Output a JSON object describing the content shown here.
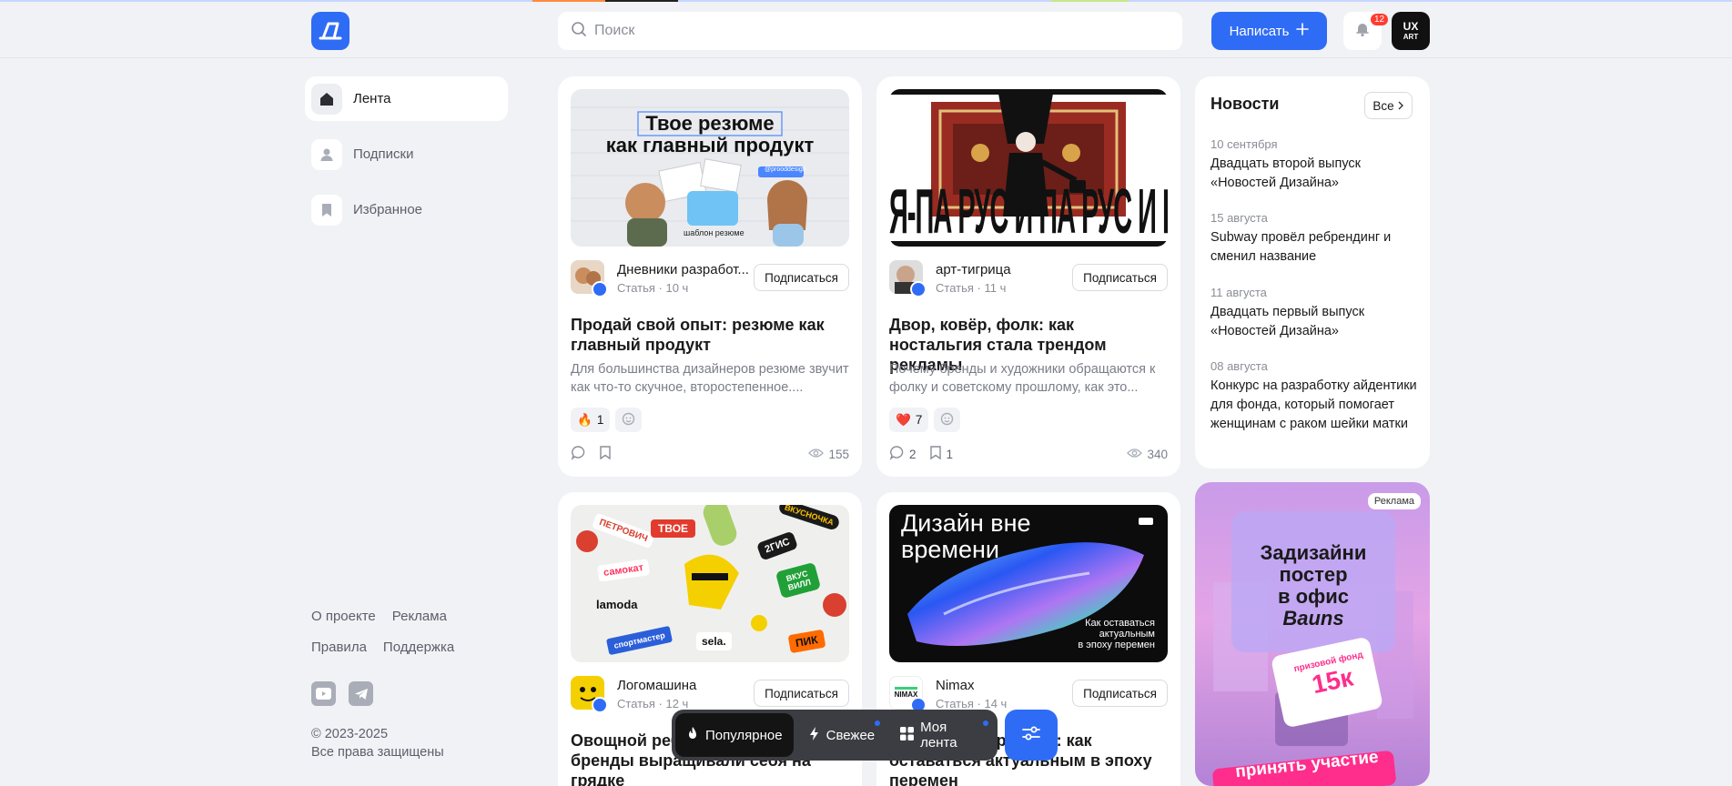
{
  "header": {
    "logo_icon": "blog-logo-icon",
    "search_placeholder": "Поиск",
    "write_label": "Написать",
    "notifications_count": "12",
    "user_avatar_line1": "UX",
    "user_avatar_line2": "ART"
  },
  "sidebar": {
    "items": [
      {
        "label": "Лента",
        "icon": "home-icon"
      },
      {
        "label": "Подписки",
        "icon": "user-icon"
      },
      {
        "label": "Избранное",
        "icon": "bookmark-icon"
      }
    ],
    "footer_links_row1": [
      "О проекте",
      "Реклама"
    ],
    "footer_links_row2": [
      "Правила",
      "Поддержка"
    ],
    "social": [
      "youtube-icon",
      "telegram-icon"
    ],
    "copyright_line1": "© 2023-2025",
    "copyright_line2": "Все права защищены"
  },
  "cards": [
    {
      "thumb_line1": "Твое резюме",
      "thumb_line2": "как главный продукт",
      "thumb_caption": "шаблон резюме",
      "thumb_tag": "@prooddesign",
      "author": "Дневники разработ...",
      "type": "Статья",
      "time": "10 ч",
      "subscribe": "Подписаться",
      "title": "Продай свой опыт: резюме как главный продукт",
      "desc": "Для большинства дизайнеров резюме звучит как что-то скучное, второстепенное....",
      "reaction_emoji": "🔥",
      "reaction_count": "1",
      "comments": "",
      "bookmarks": "",
      "views": "155"
    },
    {
      "thumb_text": "Я-ПА РУС И ПА РУС И ПА РУС И ПА РУС И-ПА РУ",
      "author": "арт-тигрица",
      "type": "Статья",
      "time": "11 ч",
      "subscribe": "Подписаться",
      "title": "Двор, ковёр, фолк: как ностальгия стала трендом рекламы",
      "desc": "Почему бренды и художники обращаются к фолку и советскому прошлому, как это...",
      "reaction_emoji": "❤️",
      "reaction_count": "7",
      "comments": "2",
      "bookmarks": "1",
      "views": "340"
    },
    {
      "stickers": [
        "ПЕТРОВИЧ",
        "ТВОЕ",
        "ВКУСНОЧКА",
        "самокат",
        "2ГИС",
        "lamoda",
        "ВКУС ВИЛЛ",
        "спортмастер",
        "sela.",
        "ПИК"
      ],
      "author": "Логомашина",
      "type": "Статья",
      "time": "12 ч",
      "subscribe": "Подписаться",
      "title": "Овощной ребрендинг: как бренды выращивали себя на грядке"
    },
    {
      "thumb_title_line1": "Дизайн вне",
      "thumb_title_line2": "времени",
      "thumb_caption_line1": "Как оставаться",
      "thumb_caption_line2": "актуальным",
      "thumb_caption_line3": "в эпоху перемен",
      "author": "Nimax",
      "author_logo": "NIMAX",
      "type": "Статья",
      "time": "14 ч",
      "subscribe": "Подписаться",
      "title": "Дизайн вне времени: как оставаться актуальным в эпоху перемен"
    }
  ],
  "news": {
    "title": "Новости",
    "all_label": "Все",
    "items": [
      {
        "date": "10 сентября",
        "text": "Двадцать второй выпуск «Новостей Дизайна»"
      },
      {
        "date": "15 августа",
        "text": "Subway провёл ребрендинг и сменил название"
      },
      {
        "date": "11 августа",
        "text": "Двадцать первый выпуск «Новостей Дизайна»"
      },
      {
        "date": "08 августа",
        "text": "Конкурс на разработку айдентики для фонда, который помогает женщинам с раком шейки матки"
      }
    ]
  },
  "ad": {
    "tag": "Реклама",
    "line1": "Задизайни",
    "line2": "постер",
    "line3": "в офис",
    "line4": "Bauns",
    "prize_label": "призовой фонд",
    "prize_value": "15к",
    "cta": "принять участие"
  },
  "bottom_tabs": [
    {
      "label": "Популярное",
      "icon": "fire-icon"
    },
    {
      "label": "Свежее",
      "icon": "lightning-icon"
    },
    {
      "label": "Моя лента",
      "icon": "grid-icon"
    }
  ],
  "filter_icon": "sliders-icon",
  "colors": {
    "accent": "#2f6cf6",
    "background": "#f1f2f5",
    "badge": "#ff3b30"
  }
}
